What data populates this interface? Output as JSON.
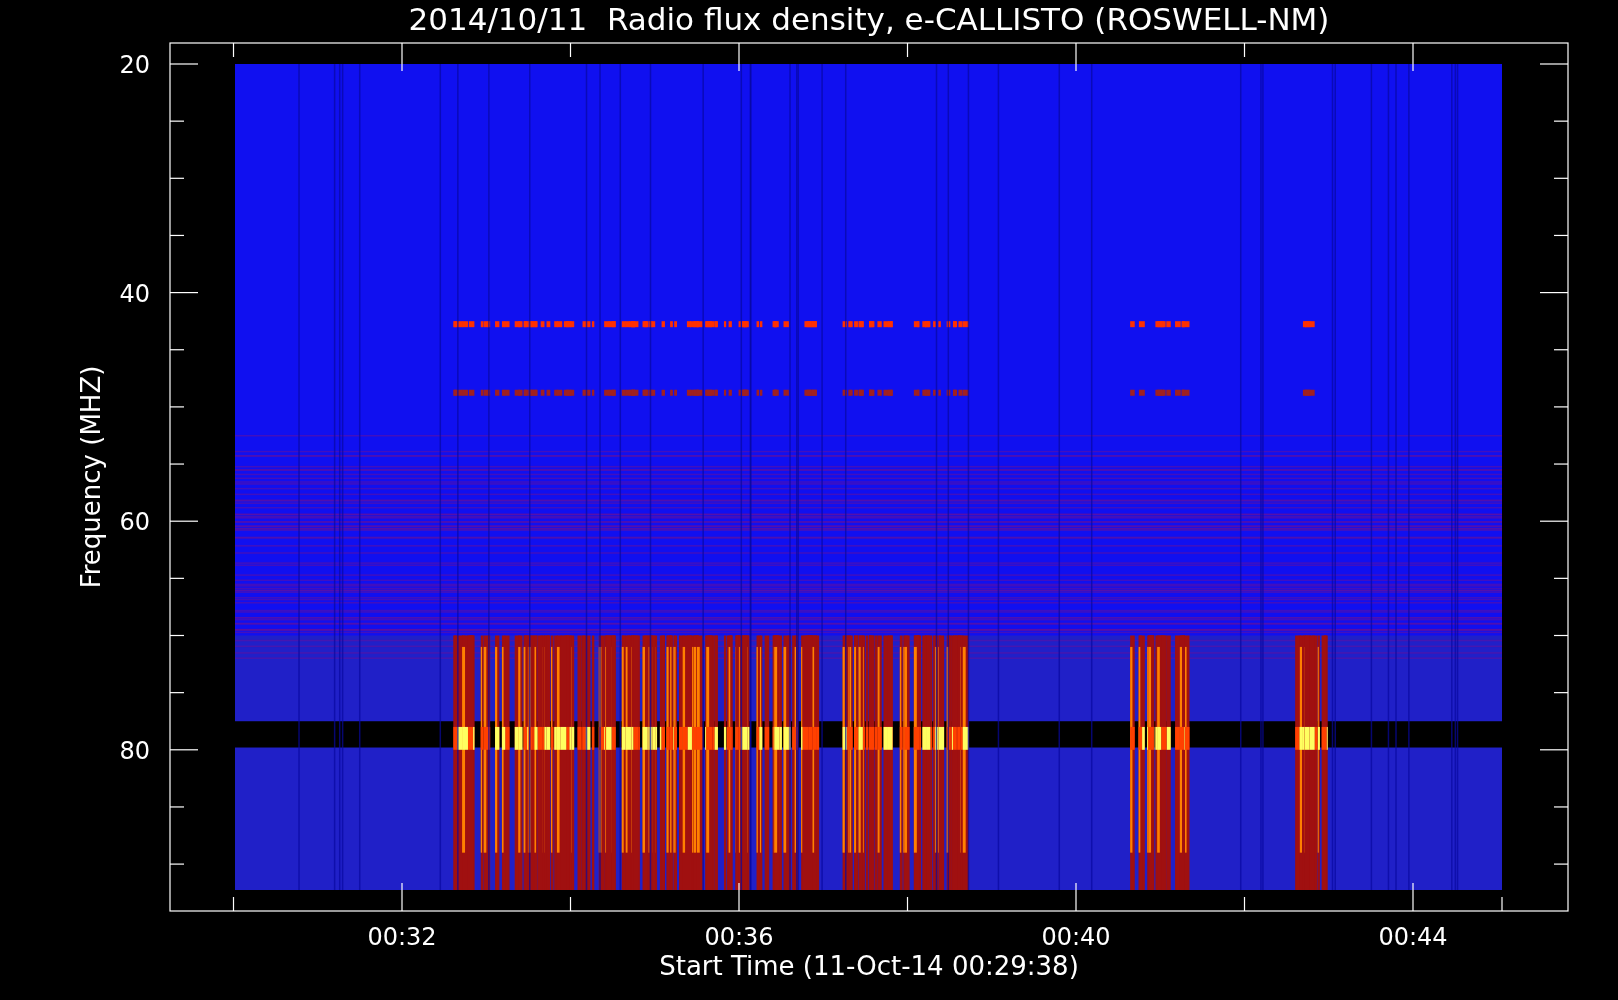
{
  "title": "2014/10/11  Radio flux density, e-CALLISTO (ROSWELL-NM)",
  "y_axis": {
    "label": "Frequency (MHZ)",
    "tick_labels": [
      "20",
      "40",
      "60",
      "80"
    ]
  },
  "x_axis": {
    "label": "Start Time (11-Oct-14 00:29:38)",
    "tick_labels": [
      "00:32",
      "00:36",
      "00:40",
      "00:44"
    ]
  }
}
